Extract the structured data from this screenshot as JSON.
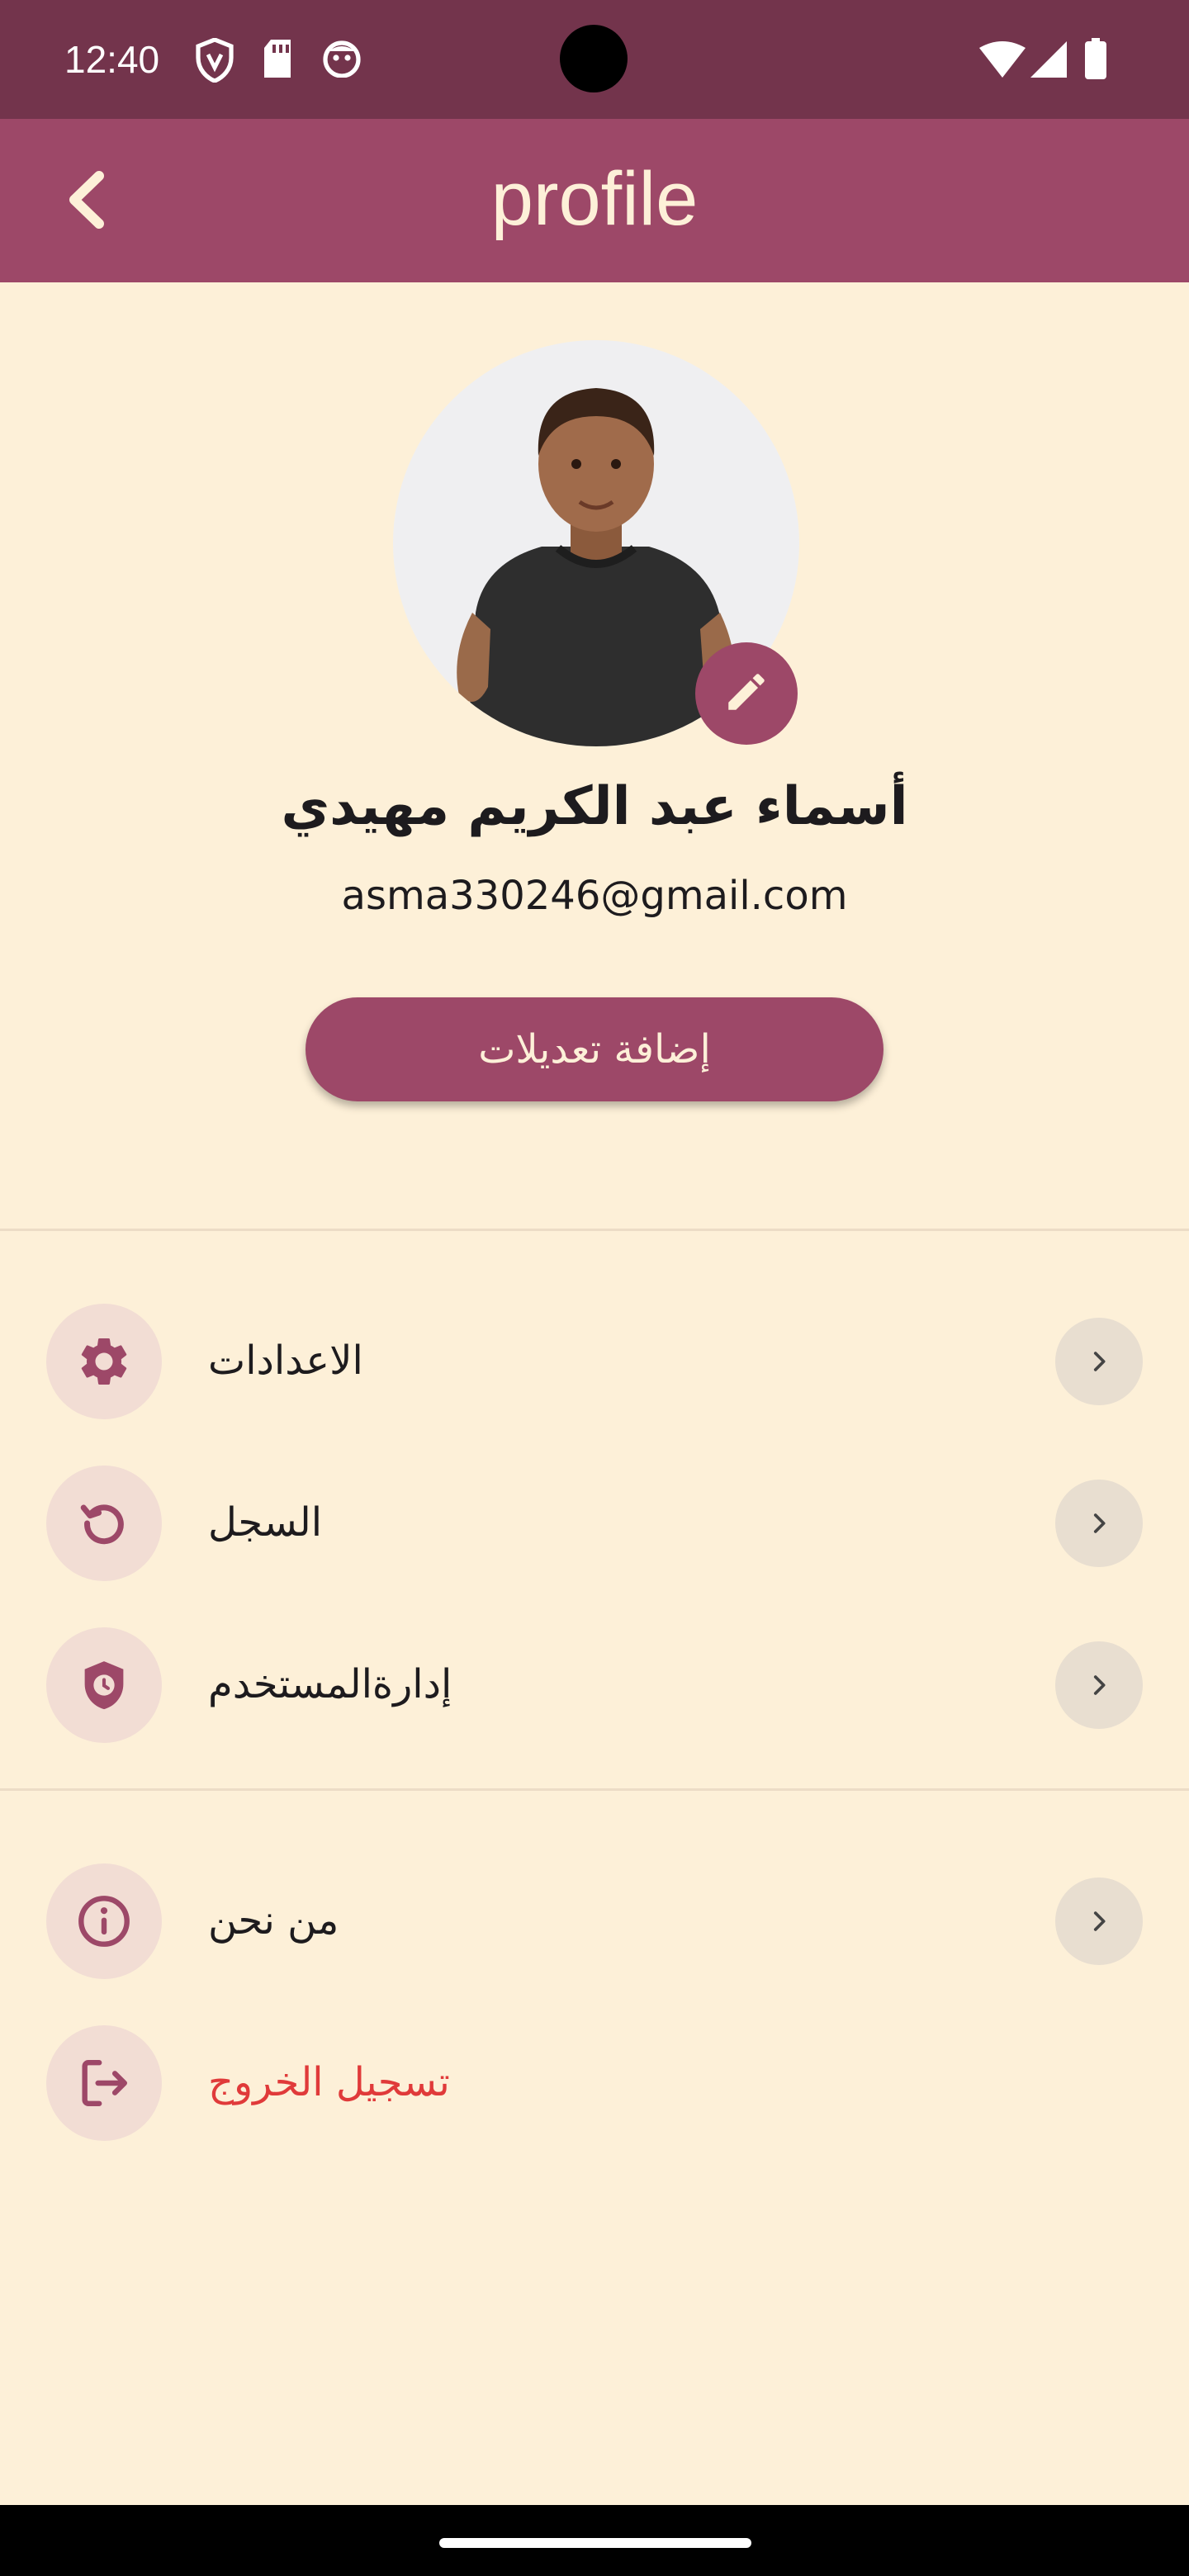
{
  "status_bar": {
    "time": "12:40",
    "icons": [
      "vpn-shield-icon",
      "sd-card-icon",
      "face-icon",
      "wifi-icon",
      "signal-icon",
      "battery-icon"
    ]
  },
  "app_bar": {
    "title": "profile",
    "back_icon": "chevron-left-icon"
  },
  "profile": {
    "name": "أسماء عبد الكريم مهيدي",
    "email": "asma330246@gmail.com",
    "edit_button_label": "إضافة تعديلات",
    "avatar_edit_icon": "pencil-icon"
  },
  "menu": {
    "settings": {
      "label": "الاعدادات",
      "icon": "gear-icon"
    },
    "history": {
      "label": "السجل",
      "icon": "history-icon"
    },
    "user_management": {
      "label": "إدارةالمستخدم",
      "icon": "shield-clock-icon"
    },
    "about": {
      "label": "من نحن",
      "icon": "info-icon"
    },
    "logout": {
      "label": "تسجيل الخروج",
      "icon": "logout-icon"
    }
  },
  "colors": {
    "status_bar": "#73344C",
    "primary": "#9D4868",
    "background": "#FDF0D8",
    "icon_circle": "#F2DDD4",
    "danger": "#E03A3A"
  }
}
